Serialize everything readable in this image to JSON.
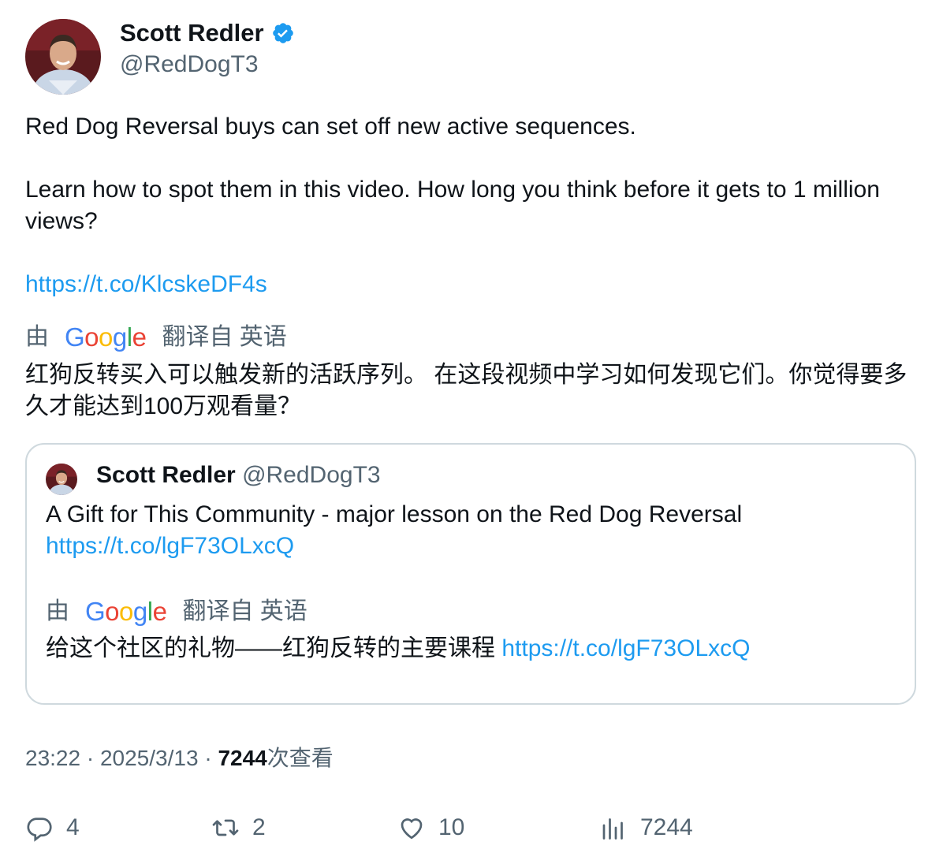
{
  "author": {
    "name": "Scott Redler",
    "handle": "@RedDogT3",
    "verified_icon": "verified-badge-icon",
    "verified_color": "#1d9bf0"
  },
  "tweet": {
    "line1": "Red Dog Reversal buys can set off new active sequences.",
    "line2": "Learn how to spot them in this video. How long you think before it gets to 1 million views?",
    "link": "https://t.co/KlcskeDF4s",
    "translation": {
      "by_label": "由",
      "google_label": "Google",
      "from_label": "翻译自 英语",
      "text": "红狗反转买入可以触发新的活跃序列。 在这段视频中学习如何发现它们。你觉得要多久才能达到100万观看量？"
    }
  },
  "quoted": {
    "name": "Scott Redler",
    "handle": "@RedDogT3",
    "text": "A Gift for This Community - major lesson on the Red Dog Reversal",
    "link": "https://t.co/lgF73OLxcQ",
    "translation": {
      "by_label": "由",
      "google_label": "Google",
      "from_label": "翻译自 英语",
      "text": "给这个社区的礼物——红狗反转的主要课程",
      "link": "https://t.co/lgF73OLxcQ"
    }
  },
  "meta": {
    "time": "23:22",
    "sep": " · ",
    "date": "2025/3/13",
    "views_count": "7244",
    "views_label": "次查看"
  },
  "actions": {
    "replies": "4",
    "retweets": "2",
    "likes": "10",
    "views": "7244"
  },
  "colors": {
    "link": "#1d9bf0",
    "secondary_text": "#536471",
    "border": "#cfd9de",
    "google_blue": "#4285f4",
    "google_red": "#ea4335",
    "google_yellow": "#fbbc05",
    "google_green": "#34a853"
  }
}
